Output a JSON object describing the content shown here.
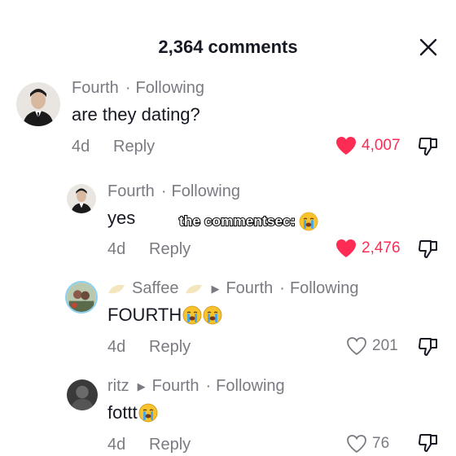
{
  "header": {
    "title": "2,364 comments"
  },
  "comments": [
    {
      "author": "Fourth",
      "separator": "·",
      "following": "Following",
      "text": "are they dating?",
      "date": "4d",
      "reply": "Reply",
      "likes": "4,007",
      "liked": true
    },
    {
      "author": "Fourth",
      "separator": "·",
      "following": "Following",
      "text": "yes",
      "date": "4d",
      "reply": "Reply",
      "likes": "2,476",
      "liked": true
    },
    {
      "author": "Saffee",
      "reply_to": "Fourth",
      "separator": "·",
      "following": "Following",
      "text": "FOURTH",
      "date": "4d",
      "reply": "Reply",
      "likes": "201",
      "liked": false
    },
    {
      "author": "ritz",
      "reply_to": "Fourth",
      "separator": "·",
      "following": "Following",
      "text": "fottt",
      "date": "4d",
      "reply": "Reply",
      "likes": "76",
      "liked": false
    }
  ],
  "overlay": {
    "caption": "the commentsec:"
  },
  "colors": {
    "like_red": "#fe2c55",
    "meta_gray": "#7a7b82",
    "text": "#161823"
  }
}
